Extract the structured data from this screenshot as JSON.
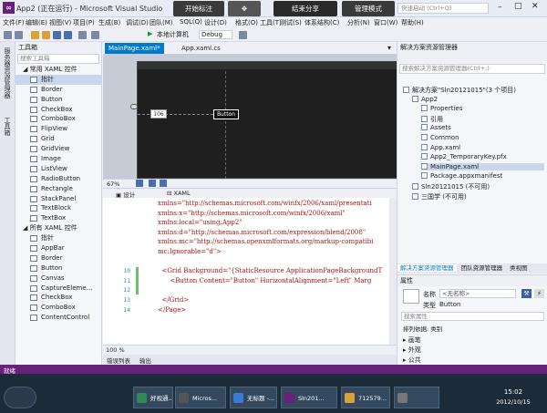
{
  "window": {
    "title": "App2 (正在运行) - Microsoft Visual Studio",
    "recording_toolbar": [
      "开始标注",
      "结束分享",
      "管理模式"
    ],
    "quick_launch_placeholder": "快速启动 (Ctrl+Q)"
  },
  "menu": [
    "文件(F)",
    "编辑(E)",
    "视图(V)",
    "项目(P)",
    "生成(B)",
    "调试(D)",
    "团队(M)",
    "SQL(Q)",
    "设计(D)",
    "格式(O)",
    "工具(T)",
    "测试(S)",
    "体系结构(C)",
    "分析(N)",
    "窗口(W)",
    "帮助(H)"
  ],
  "toolbar": {
    "run_target": "本地计算机",
    "config": "Debug"
  },
  "left_strip": [
    "服务器资源管理器",
    "工具箱"
  ],
  "toolbox": {
    "title": "工具箱",
    "search_placeholder": "搜索工具箱",
    "groups": [
      {
        "name": "常用 XAML 控件",
        "items": [
          "指针",
          "Border",
          "Button",
          "CheckBox",
          "ComboBox",
          "FlipView",
          "Grid",
          "GridView",
          "Image",
          "ListView",
          "RadioButton",
          "Rectangle",
          "StackPanel",
          "TextBlock",
          "TextBox"
        ]
      },
      {
        "name": "所有 XAML 控件",
        "items": [
          "指针",
          "AppBar",
          "Border",
          "Button",
          "Canvas",
          "CaptureEleme...",
          "CheckBox",
          "ComboBox",
          "ContentControl"
        ]
      }
    ]
  },
  "tabs": [
    {
      "label": "MainPage.xaml*",
      "active": true
    },
    {
      "label": "App.xaml.cs",
      "active": false
    }
  ],
  "designer": {
    "button_label": "Button",
    "margin_label": "106"
  },
  "split": {
    "zoom": "67%",
    "design_tab": "设计",
    "xaml_tab": "XAML"
  },
  "code": {
    "lines": [
      {
        "n": "",
        "t": "xmlns=\"http://schemas.microsoft.com/winfx/2006/xaml/presentati"
      },
      {
        "n": "",
        "t": "xmlns:x=\"http://schemas.microsoft.com/winfx/2006/xaml\""
      },
      {
        "n": "",
        "t": "xmlns:local=\"using:App2\""
      },
      {
        "n": "",
        "t": "xmlns:d=\"http://schemas.microsoft.com/expression/blend/2008\""
      },
      {
        "n": "",
        "t": "xmlns:mc=\"http://schemas.openxmlformats.org/markup-compatibi"
      },
      {
        "n": "",
        "t": "mc:Ignorable=\"d\">"
      },
      {
        "n": "",
        "t": ""
      },
      {
        "n": "10",
        "t": "  <Grid Background=\"{StaticResource ApplicationPageBackgroundT"
      },
      {
        "n": "11",
        "t": "      <Button Content=\"Button\" HorizontalAlignment=\"Left\" Marg"
      },
      {
        "n": "12",
        "t": ""
      },
      {
        "n": "13",
        "t": "  </Grid>"
      },
      {
        "n": "14",
        "t": "</Page>"
      }
    ],
    "zoom": "100 %"
  },
  "bottom_tabs": [
    "错误列表",
    "输出"
  ],
  "solution_explorer": {
    "title": "解决方案资源管理器",
    "search_placeholder": "搜索解决方案资源管理器(Ctrl+;)",
    "items": [
      {
        "label": "解决方案\"Sln20121015\"(3 个项目)",
        "indent": 0
      },
      {
        "label": "App2",
        "indent": 1
      },
      {
        "label": "Properties",
        "indent": 2
      },
      {
        "label": "引用",
        "indent": 2
      },
      {
        "label": "Assets",
        "indent": 2
      },
      {
        "label": "Common",
        "indent": 2
      },
      {
        "label": "App.xaml",
        "indent": 2
      },
      {
        "label": "App2_TemporaryKey.pfx",
        "indent": 2
      },
      {
        "label": "MainPage.xaml",
        "indent": 2,
        "selected": true
      },
      {
        "label": "Package.appxmanifest",
        "indent": 2
      },
      {
        "label": "Sln20121015 (不可用)",
        "indent": 1
      },
      {
        "label": "三国学 (不可用)",
        "indent": 1
      }
    ],
    "footer_tabs": [
      "解决方案资源管理器",
      "团队资源管理器",
      "类视图"
    ]
  },
  "properties": {
    "title": "属性",
    "name_label": "名称",
    "name_value": "<无名称>",
    "type_label": "类型",
    "type_value": "Button",
    "search_placeholder": "搜索属性",
    "arrange_label": "排列依据: 类别",
    "categories": [
      "画笔",
      "外观",
      "公共"
    ]
  },
  "status": {
    "text": "就绪"
  },
  "taskbar": {
    "tasks": [
      "好视通...",
      "Micros...",
      "无标题 -...",
      "Sln201...",
      "712579...",
      ""
    ],
    "time": "15:02",
    "date": "2012/10/15"
  },
  "colors": {
    "accent": "#007acc",
    "status_bar": "#68217a",
    "taskbar": "#1c2b3a"
  }
}
